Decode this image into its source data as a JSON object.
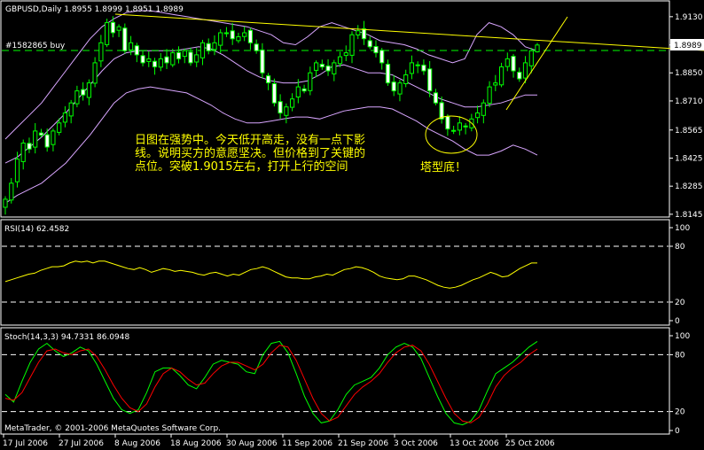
{
  "colors": {
    "background": "#000000",
    "frame": "#ffffff",
    "candle_bull": "#000000",
    "candle_bear": "#ffffff",
    "candle_edge": "#00ff00",
    "bollinger": "#d9a6ff",
    "trendline": "#ffff00",
    "buy_line": "#00ff00",
    "price_tag": "#ffffff",
    "annotation": "#ffff00",
    "rsi": "#ffff00",
    "stoch_main": "#00ff00",
    "stoch_signal": "#ff0000",
    "level_dash": "#ffffff"
  },
  "header": {
    "main": "GBPUSD,Daily  1.8955 1.8999 1.8951 1.8989",
    "order": "#1582865 buy",
    "rsi": "RSI(14) 62.4582",
    "stoch": "Stoch(14,3,3) 94.7331 86.0948",
    "copyright": "MetaTrader, © 2001-2006 MetaQuotes Software Corp."
  },
  "annotations": {
    "note_line1": "日图在强势中。今天低开高走，没有一点下影",
    "note_line2": "线。说明买方的意愿坚决。但价格到了关键的",
    "note_line3": "点位。突破1.9015左右，打开上行的空间",
    "pattern": "塔型底！"
  },
  "chart_data": [
    {
      "type": "candlestick",
      "symbol": "GBPUSD",
      "timeframe": "Daily",
      "ohlc_last": {
        "open": 1.8955,
        "high": 1.8999,
        "low": 1.8951,
        "close": 1.8989
      },
      "ylim": [
        1.814,
        1.92
      ],
      "y_ticks": [
        "1.9130",
        "1.8989",
        "1.8850",
        "1.8710",
        "1.8565",
        "1.8425",
        "1.8285",
        "1.8145"
      ],
      "current_price": "1.8989",
      "buy_level": 1.8989,
      "x_labels": [
        "17 Jul 2006",
        "27 Jul 2006",
        "8 Aug 2006",
        "18 Aug 2006",
        "30 Aug 2006",
        "11 Sep 2006",
        "21 Sep 2006",
        "3 Oct 2006",
        "13 Oct 2006",
        "25 Oct 2006"
      ],
      "close": [
        1.822,
        1.83,
        1.842,
        1.85,
        1.847,
        1.856,
        1.854,
        1.848,
        1.856,
        1.86,
        1.865,
        1.87,
        1.876,
        1.874,
        1.88,
        1.89,
        1.9,
        1.91,
        1.905,
        1.908,
        1.896,
        1.9,
        1.894,
        1.89,
        1.892,
        1.888,
        1.892,
        1.89,
        1.895,
        1.892,
        1.896,
        1.89,
        1.894,
        1.9,
        1.896,
        1.9,
        1.905,
        1.905,
        1.902,
        1.903,
        1.905,
        1.9,
        1.896,
        1.885,
        1.88,
        1.87,
        1.865,
        1.868,
        1.872,
        1.878,
        1.876,
        1.885,
        1.89,
        1.888,
        1.886,
        1.89,
        1.893,
        1.895,
        1.904,
        1.906,
        1.902,
        1.898,
        1.895,
        1.89,
        1.88,
        1.876,
        1.88,
        1.884,
        1.89,
        1.889,
        1.886,
        1.876,
        1.87,
        1.862,
        1.857,
        1.856,
        1.86,
        1.858,
        1.862,
        1.865,
        1.87,
        1.878,
        1.88,
        1.888,
        1.892,
        1.886,
        1.882,
        1.89,
        1.896,
        1.8989
      ],
      "bollinger": {
        "upper": [
          1.852,
          1.858,
          1.864,
          1.87,
          1.878,
          1.886,
          1.894,
          1.902,
          1.908,
          1.912,
          1.915,
          1.916,
          1.916,
          1.915,
          1.914,
          1.913,
          1.912,
          1.911,
          1.91,
          1.909,
          1.908,
          1.906,
          1.904,
          1.9,
          1.899,
          1.903,
          1.908,
          1.91,
          1.908,
          1.906,
          1.904,
          1.901,
          1.9,
          1.899,
          1.897,
          1.894,
          1.892,
          1.89,
          1.892,
          1.904,
          1.91,
          1.908,
          1.904,
          1.898,
          1.896
        ],
        "middle": [
          1.84,
          1.843,
          1.848,
          1.853,
          1.859,
          1.865,
          1.872,
          1.879,
          1.886,
          1.892,
          1.895,
          1.896,
          1.896,
          1.896,
          1.896,
          1.897,
          1.898,
          1.897,
          1.894,
          1.89,
          1.886,
          1.883,
          1.881,
          1.88,
          1.88,
          1.881,
          1.884,
          1.888,
          1.889,
          1.887,
          1.885,
          1.885,
          1.884,
          1.881,
          1.878,
          1.875,
          1.872,
          1.87,
          1.868,
          1.868,
          1.869,
          1.87,
          1.872,
          1.874,
          1.874
        ],
        "lower": [
          1.82,
          1.824,
          1.827,
          1.83,
          1.835,
          1.84,
          1.847,
          1.854,
          1.862,
          1.87,
          1.875,
          1.877,
          1.878,
          1.877,
          1.876,
          1.875,
          1.872,
          1.869,
          1.865,
          1.862,
          1.86,
          1.86,
          1.861,
          1.862,
          1.863,
          1.863,
          1.862,
          1.864,
          1.866,
          1.867,
          1.868,
          1.868,
          1.867,
          1.864,
          1.861,
          1.857,
          1.854,
          1.851,
          1.847,
          1.844,
          1.844,
          1.846,
          1.849,
          1.847,
          1.844
        ]
      }
    },
    {
      "type": "line",
      "title": "RSI(14) 62.4582",
      "ylim": [
        0,
        100
      ],
      "y_ticks": [
        "100",
        "80",
        "20",
        "0"
      ],
      "levels": [
        80,
        20
      ],
      "values": [
        42,
        44,
        46,
        48,
        50,
        51,
        54,
        56,
        58,
        58,
        59,
        62,
        64,
        63,
        64,
        62,
        64,
        64,
        62,
        60,
        58,
        56,
        55,
        57,
        55,
        52,
        54,
        56,
        55,
        53,
        54,
        53,
        52,
        50,
        49,
        51,
        52,
        50,
        48,
        50,
        49,
        52,
        55,
        56,
        58,
        56,
        53,
        50,
        47,
        46,
        46,
        45,
        45,
        47,
        48,
        50,
        49,
        52,
        55,
        56,
        58,
        57,
        55,
        52,
        48,
        46,
        45,
        44,
        45,
        48,
        48,
        46,
        44,
        41,
        38,
        36,
        35,
        36,
        38,
        41,
        44,
        46,
        49,
        52,
        50,
        47,
        48,
        52,
        56,
        59,
        62,
        62
      ]
    },
    {
      "type": "line",
      "title": "Stoch(14,3,3) 94.7331 86.0948",
      "ylim": [
        0,
        100
      ],
      "y_ticks": [
        "100",
        "80",
        "20",
        "0"
      ],
      "levels": [
        80,
        20
      ],
      "series": [
        {
          "name": "main",
          "values": [
            38,
            30,
            52,
            72,
            86,
            92,
            84,
            78,
            82,
            88,
            84,
            70,
            52,
            34,
            22,
            18,
            22,
            40,
            62,
            66,
            66,
            58,
            48,
            44,
            56,
            70,
            74,
            72,
            70,
            62,
            60,
            80,
            92,
            94,
            82,
            60,
            36,
            18,
            8,
            10,
            22,
            38,
            48,
            52,
            56,
            66,
            80,
            88,
            92,
            88,
            76,
            56,
            36,
            18,
            8,
            6,
            10,
            22,
            42,
            60,
            66,
            72,
            80,
            88,
            94
          ]
        },
        {
          "name": "signal",
          "values": [
            34,
            32,
            40,
            56,
            72,
            84,
            86,
            82,
            80,
            84,
            86,
            78,
            64,
            48,
            34,
            24,
            20,
            28,
            46,
            60,
            66,
            62,
            54,
            48,
            50,
            60,
            68,
            72,
            72,
            68,
            64,
            70,
            82,
            90,
            88,
            74,
            54,
            34,
            18,
            10,
            14,
            26,
            38,
            46,
            52,
            60,
            72,
            82,
            88,
            90,
            84,
            70,
            52,
            34,
            18,
            10,
            8,
            14,
            28,
            46,
            58,
            66,
            72,
            80,
            86
          ]
        }
      ]
    }
  ]
}
